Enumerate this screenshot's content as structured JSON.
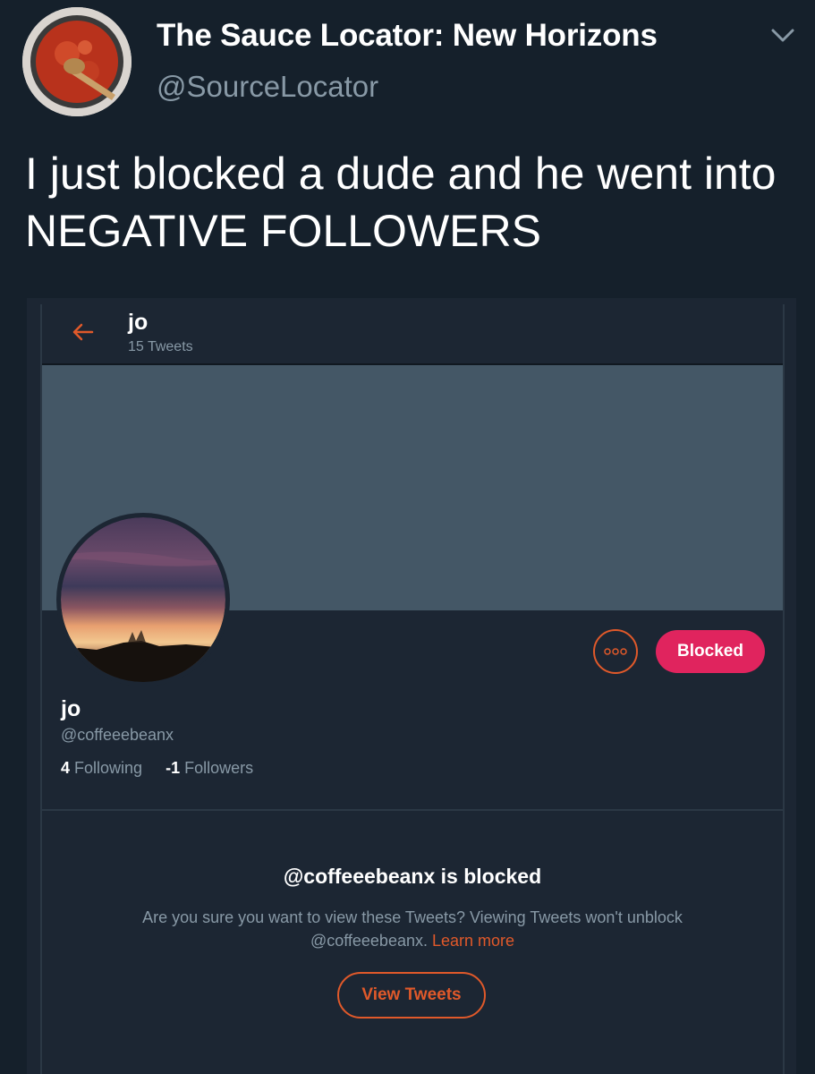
{
  "tweet": {
    "display_name": "The Sauce Locator: New Horizons",
    "handle": "@SourceLocator",
    "text": "I just blocked a dude and he went into NEGATIVE FOLLOWERS",
    "avatar_icon": "sauce-pot-avatar",
    "menu_icon": "chevron-down-icon"
  },
  "embedded_profile": {
    "header": {
      "back_icon": "back-arrow-icon",
      "name": "jo",
      "tweet_count": "15 Tweets"
    },
    "profile": {
      "name": "jo",
      "handle": "@coffeeebeanx",
      "following_count": "4",
      "following_label": "Following",
      "followers_count": "-1",
      "followers_label": "Followers"
    },
    "actions": {
      "more_icon": "more-options-icon",
      "blocked_label": "Blocked"
    },
    "blocked_notice": {
      "title": "@coffeeebeanx is blocked",
      "line1": "Are you sure you want to view these Tweets? Viewing Tweets won't unblock",
      "line2": "@coffeeebeanx.",
      "learn_more": "Learn more",
      "view_button": "View Tweets"
    }
  },
  "colors": {
    "background": "#15202b",
    "accent": "#e0592a",
    "blocked": "#e0245e",
    "banner": "#445766",
    "muted_text": "#8899a6"
  }
}
